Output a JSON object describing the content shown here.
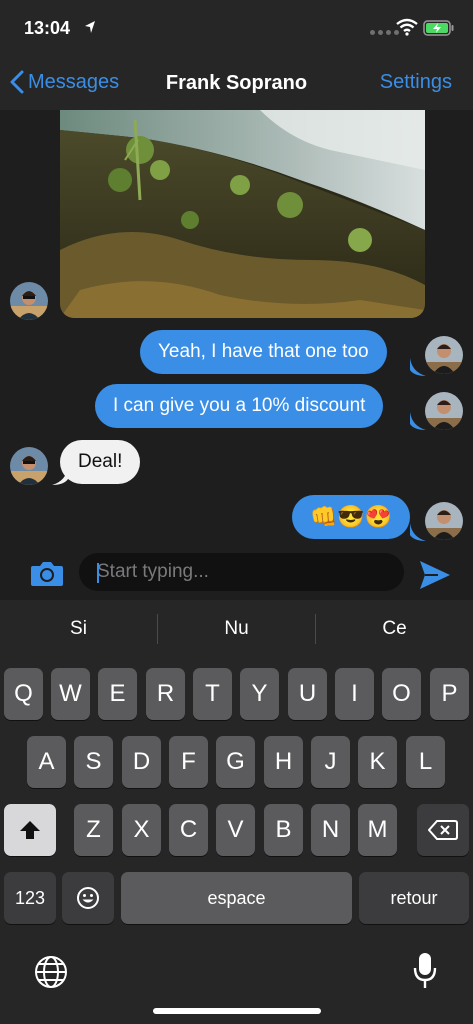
{
  "status_bar": {
    "time": "13:04",
    "icons": [
      "location-arrow-icon",
      "signal-dots-icon",
      "wifi-icon",
      "battery-charging-icon"
    ]
  },
  "nav": {
    "back_label": "Messages",
    "title": "Frank Soprano",
    "settings_label": "Settings"
  },
  "messages": [
    {
      "type": "image",
      "direction": "incoming",
      "description_icon": "photo-waterfall"
    },
    {
      "type": "text",
      "direction": "outgoing",
      "text": "Yeah, I have that one too"
    },
    {
      "type": "text",
      "direction": "outgoing",
      "text": "I can give you a 10% discount"
    },
    {
      "type": "text",
      "direction": "incoming",
      "text": "Deal!"
    },
    {
      "type": "text",
      "direction": "outgoing",
      "text": "👊😎😍"
    }
  ],
  "composer": {
    "placeholder": "Start typing...",
    "camera_icon": "camera-icon",
    "send_icon": "send-icon"
  },
  "keyboard": {
    "predictions": [
      "Si",
      "Nu",
      "Ce"
    ],
    "row1": [
      "Q",
      "W",
      "E",
      "R",
      "T",
      "Y",
      "U",
      "I",
      "O",
      "P"
    ],
    "row2": [
      "A",
      "S",
      "D",
      "F",
      "G",
      "H",
      "J",
      "K",
      "L"
    ],
    "row3": [
      "Z",
      "X",
      "C",
      "V",
      "B",
      "N",
      "M"
    ],
    "numbers_label": "123",
    "space_label": "espace",
    "return_label": "retour"
  },
  "colors": {
    "accent": "#3a8ee6",
    "background": "#1e1e1f",
    "incoming_bubble": "#f1f1f2"
  }
}
